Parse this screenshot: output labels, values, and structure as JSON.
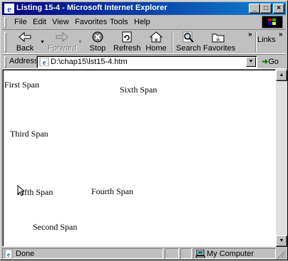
{
  "window": {
    "title": "Listing 15-4 - Microsoft Internet Explorer"
  },
  "window_controls": {
    "minimize": "_",
    "maximize": "□",
    "close": "×"
  },
  "menu": [
    {
      "label": "File"
    },
    {
      "label": "Edit"
    },
    {
      "label": "View"
    },
    {
      "label": "Favorites"
    },
    {
      "label": "Tools"
    },
    {
      "label": "Help"
    }
  ],
  "toolbar": {
    "back": "Back",
    "forward": "Forward",
    "stop": "Stop",
    "refresh": "Refresh",
    "home": "Home",
    "search": "Search",
    "favorites": "Favorites",
    "links": "Links",
    "more": "»",
    "dropdown": "▼"
  },
  "address": {
    "label": "Address",
    "value": "D:\\chap15\\lst15-4.htm",
    "go": "Go",
    "go_arrow": "➜"
  },
  "page": {
    "spans": [
      "First Span",
      "Second Span",
      "Third Span",
      "Fourth Span",
      "Fifth Span",
      "Sixth Span"
    ]
  },
  "scrollbar": {
    "up": "▲",
    "down": "▼"
  },
  "status": {
    "text": "Done",
    "zone": "My Computer"
  },
  "colors": {
    "title_start": "#000080",
    "title_end": "#1084d0",
    "face": "#c0c0c0"
  }
}
